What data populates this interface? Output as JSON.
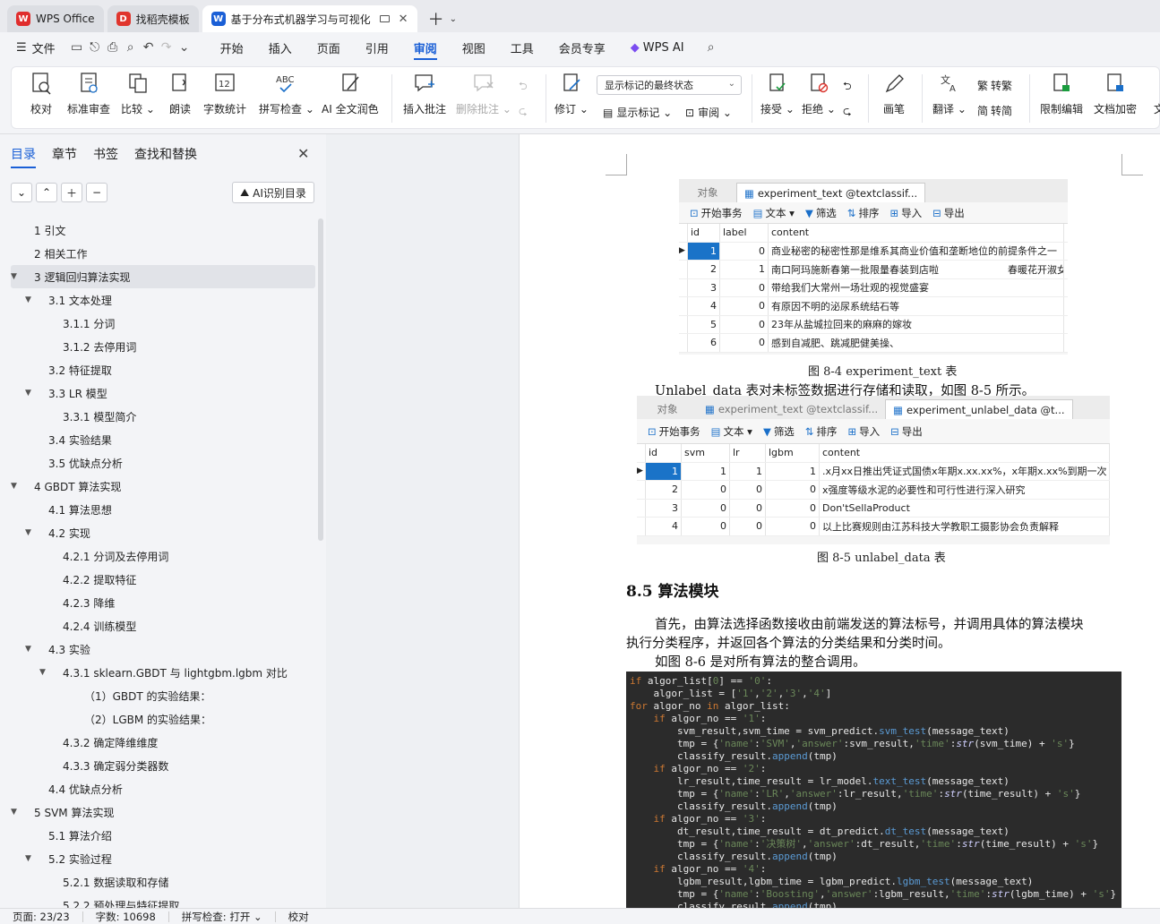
{
  "tabs": [
    {
      "label": "WPS Office",
      "color": "#e02d2d",
      "glyph": "W"
    },
    {
      "label": "找稻壳模板",
      "color": "#e0352d",
      "glyph": "D"
    },
    {
      "label": "基于分布式机器学习与可视化",
      "color": "#1a5fd6",
      "glyph": "W",
      "active": true
    }
  ],
  "menu": {
    "file": "文件",
    "items": [
      "开始",
      "插入",
      "页面",
      "引用",
      "审阅",
      "视图",
      "工具",
      "会员专享"
    ],
    "active": "审阅",
    "wpsai": "WPS AI"
  },
  "ribbon": {
    "buttons": [
      "校对",
      "标准审查",
      "比较",
      "朗读",
      "字数统计",
      "拼写检查",
      "AI 全文润色",
      "插入批注",
      "删除批注",
      "修订",
      "画笔",
      "翻译",
      "限制编辑",
      "文档加密",
      "文"
    ],
    "select_value": "显示标记的最终状态",
    "show_markup": "显示标记",
    "review": "审阅",
    "accept": "接受",
    "reject": "拒绝",
    "trad": "转繁",
    "simp": "转简"
  },
  "left": {
    "tabs": [
      "目录",
      "章节",
      "书签",
      "查找和替换"
    ],
    "ai_button": "AI识别目录",
    "toc": [
      {
        "label": "1 引文",
        "level": 1
      },
      {
        "label": "2 相关工作",
        "level": 1
      },
      {
        "label": "3 逻辑回归算法实现",
        "level": 1,
        "expanded": true,
        "selected": true
      },
      {
        "label": "3.1 文本处理",
        "level": 2,
        "expanded": true
      },
      {
        "label": "3.1.1 分词",
        "level": 3
      },
      {
        "label": "3.1.2 去停用词",
        "level": 3
      },
      {
        "label": "3.2 特征提取",
        "level": 2
      },
      {
        "label": "3.3 LR 模型",
        "level": 2,
        "expanded": true
      },
      {
        "label": "3.3.1 模型简介",
        "level": 3
      },
      {
        "label": "3.4  实验结果",
        "level": 2
      },
      {
        "label": "3.5  优缺点分析",
        "level": 2
      },
      {
        "label": "4 GBDT 算法实现",
        "level": 1,
        "expanded": true
      },
      {
        "label": "4.1 算法思想",
        "level": 2
      },
      {
        "label": "4.2 实现",
        "level": 2,
        "expanded": true
      },
      {
        "label": "4.2.1 分词及去停用词",
        "level": 3
      },
      {
        "label": "4.2.2 提取特征",
        "level": 3
      },
      {
        "label": "4.2.3 降维",
        "level": 3
      },
      {
        "label": "4.2.4 训练模型",
        "level": 3
      },
      {
        "label": "4.3 实验",
        "level": 2,
        "expanded": true
      },
      {
        "label": "4.3.1 sklearn.GBDT 与 lightgbm.lgbm 对比",
        "level": 3,
        "expanded": true
      },
      {
        "label": "（1）GBDT 的实验结果：",
        "level": 4
      },
      {
        "label": "（2）LGBM 的实验结果：",
        "level": 4
      },
      {
        "label": "4.3.2  确定降维维度",
        "level": 3
      },
      {
        "label": "4.3.3  确定弱分类器数",
        "level": 3
      },
      {
        "label": "4.4  优缺点分析",
        "level": 2
      },
      {
        "label": "5    SVM 算法实现",
        "level": 1,
        "expanded": true
      },
      {
        "label": "5.1 算法介绍",
        "level": 2
      },
      {
        "label": "5.2 实验过程",
        "level": 2,
        "expanded": true
      },
      {
        "label": "5.2.1  数据读取和存储",
        "level": 3
      },
      {
        "label": "5.2.2  预处理与特征提取",
        "level": 3
      }
    ]
  },
  "doc": {
    "shot1": {
      "tabs": [
        "对象",
        "experiment_text @textclassif..."
      ],
      "toolbar": [
        "开始事务",
        "文本",
        "筛选",
        "排序",
        "导入",
        "导出"
      ],
      "columns": [
        "id",
        "label",
        "content"
      ],
      "rows": [
        [
          "1",
          "0",
          "商业秘密的秘密性那是维系其商业价值和垄断地位的前提条件之一"
        ],
        [
          "2",
          "1",
          "南口阿玛施新春第一批限量春装到店啦　　　　　　　春暖花开淑女裙"
        ],
        [
          "3",
          "0",
          "带给我们大常州一场壮观的视觉盛宴"
        ],
        [
          "4",
          "0",
          "有原因不明的泌尿系统结石等"
        ],
        [
          "5",
          "0",
          "23年从盐城拉回来的麻麻的嫁妆"
        ],
        [
          "6",
          "0",
          "感到自减肥、跳减肥健美操、"
        ]
      ]
    },
    "caption1": "图 8-4 experiment_text 表",
    "para1": "Unlabel_data 表对未标签数据进行存储和读取，如图 8-5 所示。",
    "shot2": {
      "tabs": [
        "对象",
        "experiment_text @textclassif...",
        "experiment_unlabel_data @t..."
      ],
      "toolbar": [
        "开始事务",
        "文本",
        "筛选",
        "排序",
        "导入",
        "导出"
      ],
      "columns": [
        "id",
        "svm",
        "lr",
        "lgbm",
        "content"
      ],
      "rows": [
        [
          "1",
          "1",
          "1",
          "1",
          ".x月xx日推出凭证式国债x年期x.xx.xx%，x年期x.xx%到期一次"
        ],
        [
          "2",
          "0",
          "0",
          "0",
          "x强度等级水泥的必要性和可行性进行深入研究"
        ],
        [
          "3",
          "0",
          "0",
          "0",
          "Don'tSellaProduct"
        ],
        [
          "4",
          "0",
          "0",
          "0",
          "以上比赛规则由江苏科技大学教职工摄影协会负责解释"
        ]
      ]
    },
    "caption2": "图 8-5 unlabel_data 表",
    "heading": "8.5 算法模块",
    "para2a": "首先，由算法选择函数接收由前端发送的算法标号，并调用具体的算法模块",
    "para2b": "执行分类程序，并返回各个算法的分类结果和分类时间。",
    "para3": "如图 8-6 是对所有算法的整合调用。"
  },
  "status": {
    "page": "页面: 23/23",
    "words": "字数: 10698",
    "spell": "拼写检查: 打开",
    "proof": "校对"
  }
}
